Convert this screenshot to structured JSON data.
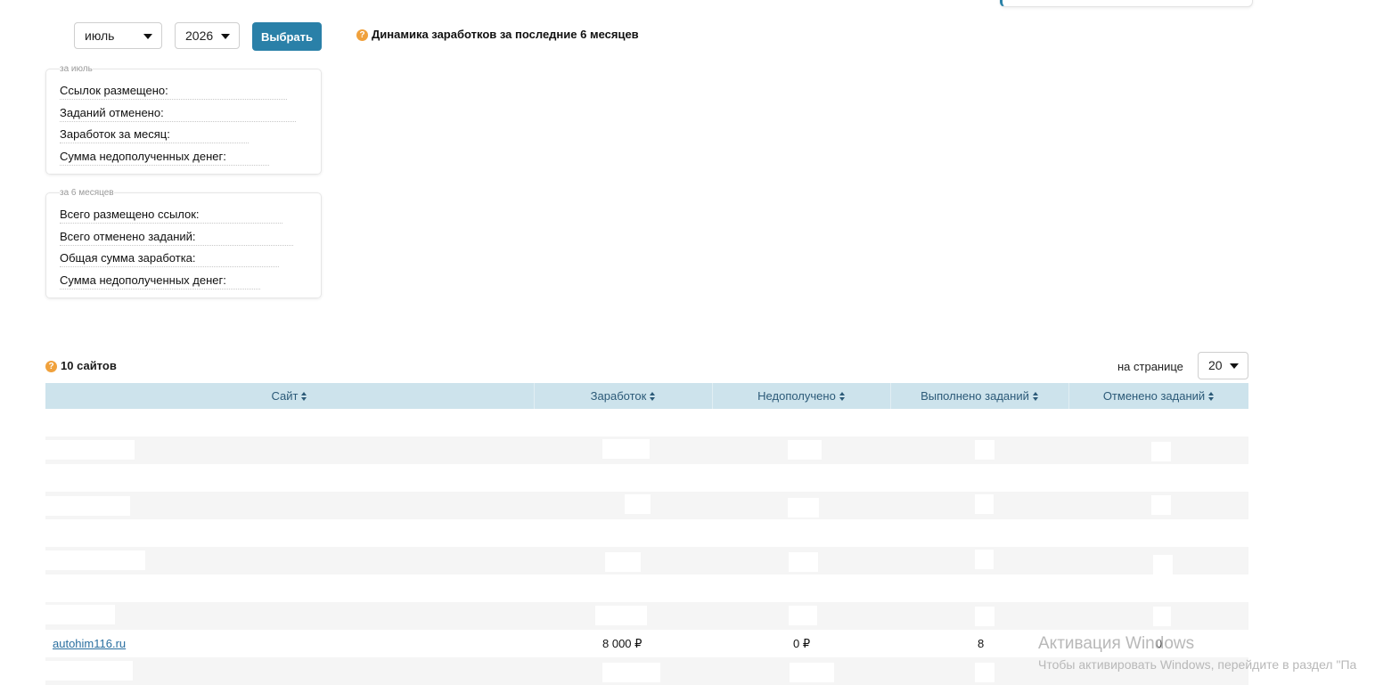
{
  "filters": {
    "month": "июль",
    "year": "2026",
    "choose_label": "Выбрать"
  },
  "chart": {
    "title": "Динамика заработков за последние 6 месяцев"
  },
  "month_stats": {
    "legend": "за июль",
    "rows": [
      "Ссылок размещено:",
      "Заданий отменено:",
      "Заработок за месяц:",
      "Сумма недополученных денег:"
    ]
  },
  "six_month_stats": {
    "legend": "за 6 месяцев",
    "rows": [
      "Всего размещено ссылок:",
      "Всего отменено заданий:",
      "Общая сумма заработка:",
      "Сумма недополученных денег:"
    ]
  },
  "sites": {
    "count_label": "10 сайтов",
    "per_page_label": "на странице",
    "per_page_value": "20",
    "columns": [
      "Сайт",
      "Заработок",
      "Недополучено",
      "Выполнено заданий",
      "Отменено заданий"
    ],
    "visible_row": {
      "site": "autohim116.ru",
      "earnings": "8 000 ₽",
      "missed": "0 ₽",
      "completed": "8",
      "cancelled": "0"
    }
  },
  "watermark": {
    "title": "Активация Windows",
    "subtitle": "Чтобы активировать Windows, перейдите в раздел \"Па"
  },
  "colors": {
    "accent": "#2a80a8",
    "table_header": "#cde3ec",
    "help_icon": "#f0a13c"
  }
}
